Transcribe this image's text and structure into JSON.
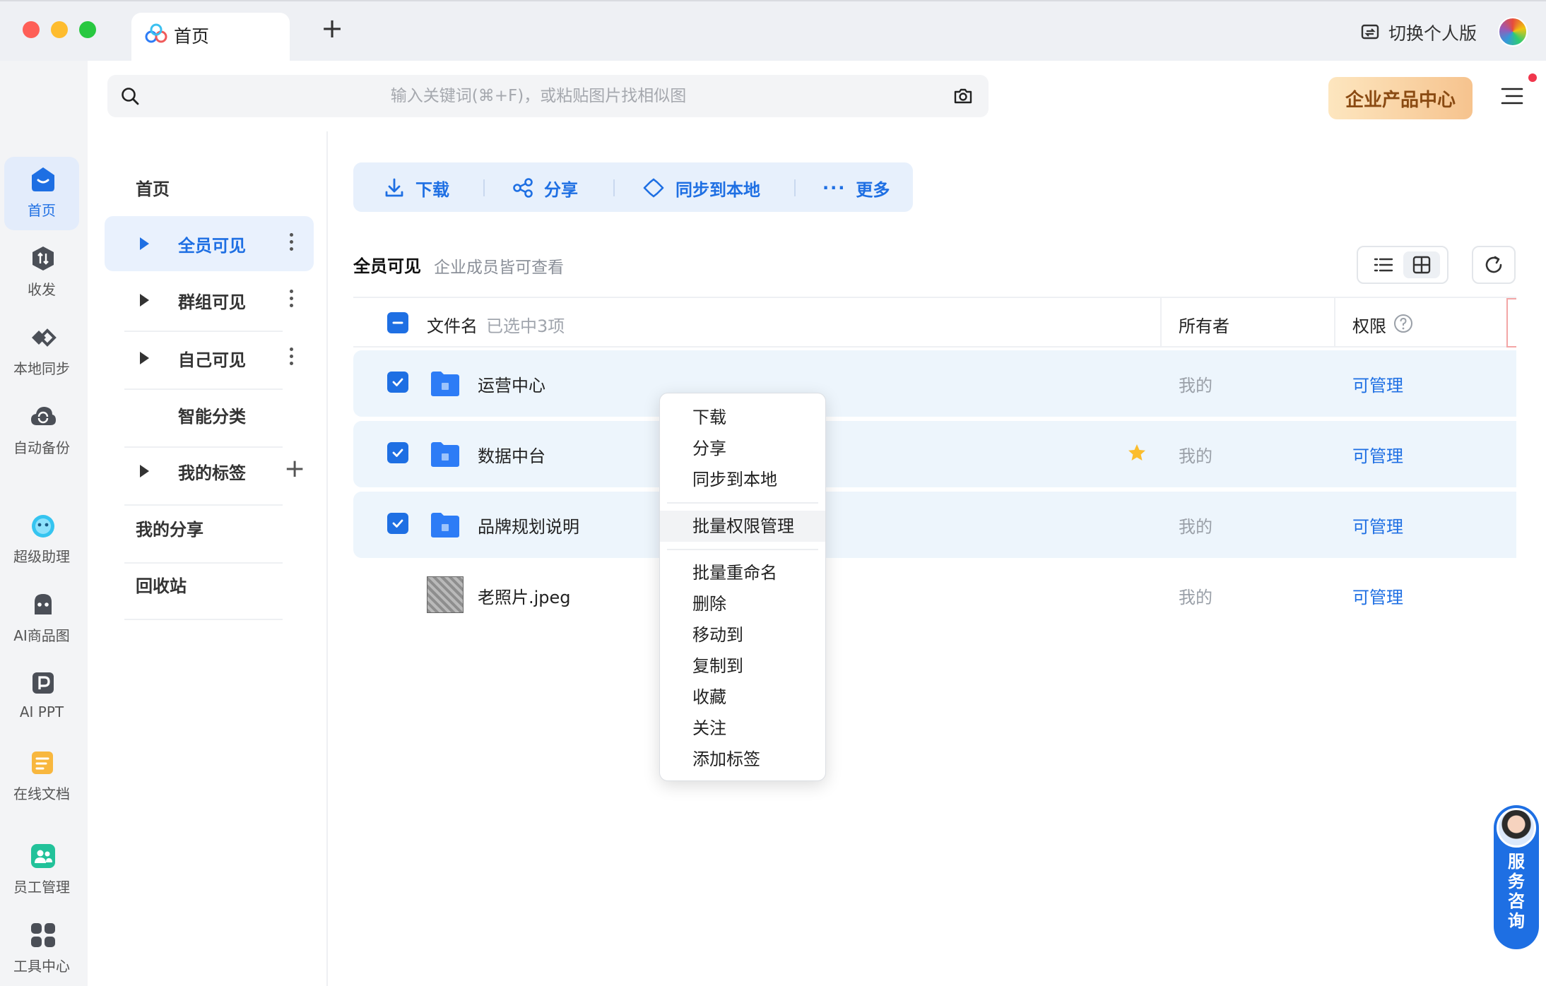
{
  "tab": {
    "title": "首页",
    "add_label": "+"
  },
  "header": {
    "switch_label": "切换个人版"
  },
  "search": {
    "placeholder": "输入关键词(⌘+F)，或粘贴图片找相似图"
  },
  "enterprise": {
    "label": "企业产品中心"
  },
  "rail": {
    "items": [
      {
        "label": "首页",
        "icon": "home-icon",
        "active": true
      },
      {
        "label": "收发",
        "icon": "transfer-icon"
      },
      {
        "label": "本地同步",
        "icon": "sync-icon"
      },
      {
        "label": "自动备份",
        "icon": "backup-icon"
      },
      {
        "label": "超级助理",
        "icon": "assistant-icon"
      },
      {
        "label": "AI商品图",
        "icon": "ai-product-icon"
      },
      {
        "label": "AI PPT",
        "icon": "ai-ppt-icon"
      },
      {
        "label": "在线文档",
        "icon": "doc-icon"
      },
      {
        "label": "员工管理",
        "icon": "staff-icon"
      },
      {
        "label": "工具中心",
        "icon": "tools-icon"
      }
    ]
  },
  "nav": {
    "home": "首页",
    "all_visible": "全员可见",
    "group_visible": "群组可见",
    "self_visible": "自己可见",
    "smart_category": "智能分类",
    "my_tags": "我的标签",
    "my_share": "我的分享",
    "recycle": "回收站"
  },
  "toolbar": {
    "download": "下载",
    "share": "分享",
    "sync_local": "同步到本地",
    "more": "更多"
  },
  "heading": {
    "title": "全员可见",
    "subtitle": "企业成员皆可查看"
  },
  "table": {
    "col_name": "文件名",
    "selected_text": "已选中3项",
    "col_owner": "所有者",
    "col_perm": "权限",
    "rows": [
      {
        "name": "运营中心",
        "owner": "我的",
        "perm": "可管理",
        "selected": true,
        "starred": false,
        "type": "folder"
      },
      {
        "name": "数据中台",
        "owner": "我的",
        "perm": "可管理",
        "selected": true,
        "starred": true,
        "type": "folder"
      },
      {
        "name": "品牌规划说明",
        "owner": "我的",
        "perm": "可管理",
        "selected": true,
        "starred": false,
        "type": "folder"
      },
      {
        "name": "老照片.jpeg",
        "owner": "我的",
        "perm": "可管理",
        "selected": false,
        "starred": false,
        "type": "image"
      }
    ]
  },
  "context_menu": {
    "items": [
      "下载",
      "分享",
      "同步到本地",
      "批量权限管理",
      "批量重命名",
      "删除",
      "移动到",
      "复制到",
      "收藏",
      "关注",
      "添加标签"
    ]
  },
  "service": {
    "label": "服务咨询"
  },
  "colors": {
    "accent": "#1e6fe3",
    "selected_row": "#edf5fc",
    "enterprise_text": "#8a4a12"
  }
}
